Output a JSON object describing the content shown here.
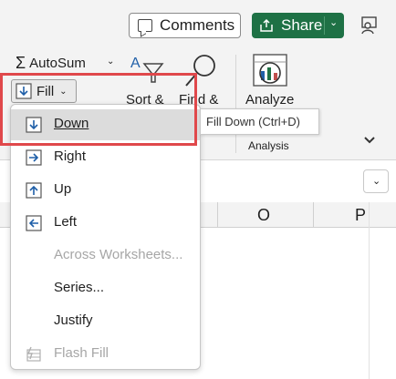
{
  "header": {
    "comments_label": "Comments",
    "share_label": "Share",
    "share_chevron": "⌄"
  },
  "ribbon": {
    "autosum_symbol": "Σ",
    "autosum_label": "AutoSum",
    "autosum_chevron": "⌄",
    "fill_label": "Fill",
    "fill_chevron": "⌄",
    "sort_label": "Sort &",
    "find_label": "Find &",
    "analyze_label": "Analyze",
    "analysis_group_label": "Analysis"
  },
  "tooltip": {
    "text": "Fill Down (Ctrl+D)"
  },
  "columns": {
    "o": "O",
    "p": "P"
  },
  "fill_menu": {
    "items": [
      {
        "label": "Down",
        "icon": "fill-down-icon",
        "selected": true,
        "disabled": false
      },
      {
        "label": "Right",
        "icon": "fill-right-icon",
        "selected": false,
        "disabled": false
      },
      {
        "label": "Up",
        "icon": "fill-up-icon",
        "selected": false,
        "disabled": false
      },
      {
        "label": "Left",
        "icon": "fill-left-icon",
        "selected": false,
        "disabled": false
      },
      {
        "label": "Across Worksheets...",
        "icon": "",
        "selected": false,
        "disabled": true
      },
      {
        "label": "Series...",
        "icon": "",
        "selected": false,
        "disabled": false
      },
      {
        "label": "Justify",
        "icon": "",
        "selected": false,
        "disabled": false
      },
      {
        "label": "Flash Fill",
        "icon": "flash-fill-icon",
        "selected": false,
        "disabled": true
      }
    ]
  },
  "colors": {
    "share_green": "#1e7145",
    "highlight_red": "#e0484b",
    "icon_blue": "#1f5fa8"
  }
}
